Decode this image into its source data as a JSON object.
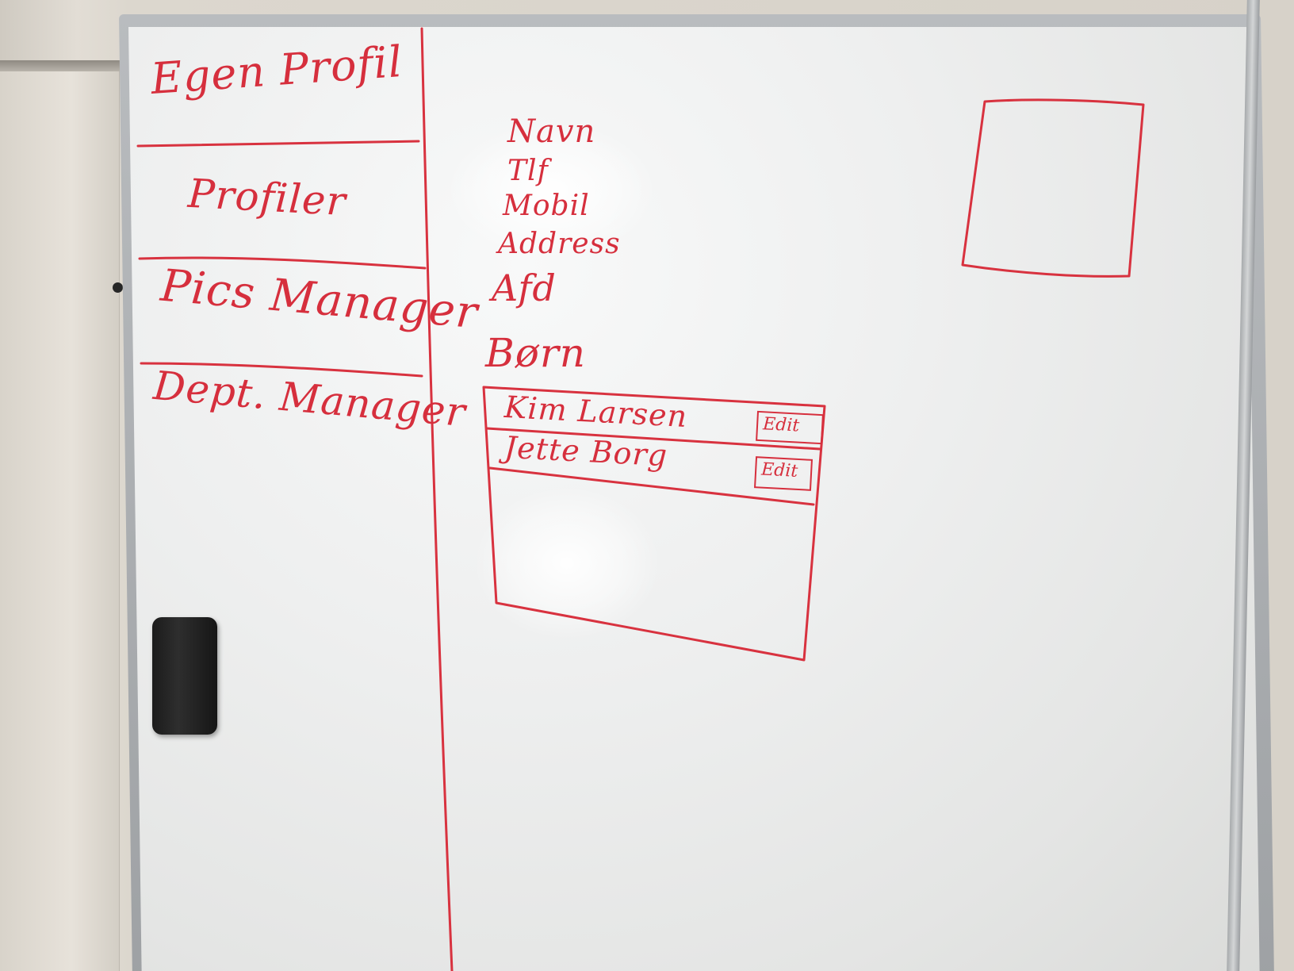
{
  "whiteboard": {
    "ink_color": "#d62f3d",
    "nav": {
      "items": [
        {
          "label": "Egen Profil"
        },
        {
          "label": "Profiler"
        },
        {
          "label": "Pics Manager"
        },
        {
          "label": "Dept. Manager"
        }
      ]
    },
    "profile": {
      "fields": [
        "Navn",
        "Tlf",
        "Mobil",
        "Address",
        "Afd"
      ],
      "children_label": "Børn",
      "children": [
        {
          "name": "Kim Larsen",
          "action": "Edit"
        },
        {
          "name": "Jette Borg",
          "action": "Edit"
        }
      ]
    },
    "photo_placeholder": "image-placeholder-box"
  }
}
